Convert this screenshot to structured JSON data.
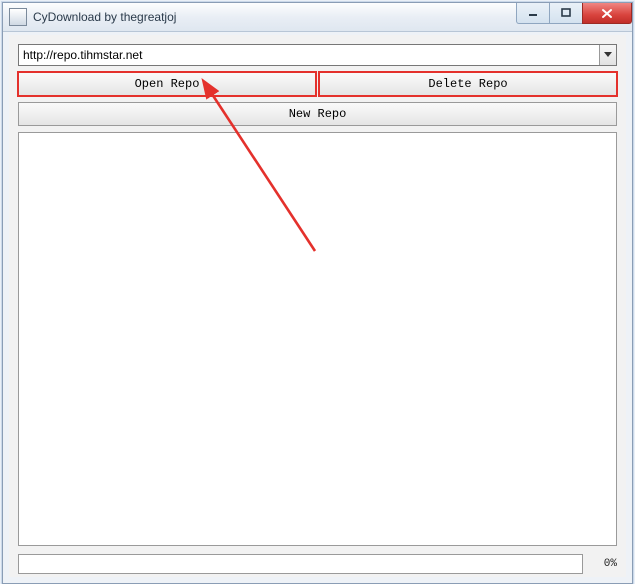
{
  "window": {
    "title": "CyDownload by thegreatjoj"
  },
  "url_field": {
    "value": "http://repo.tihmstar.net"
  },
  "buttons": {
    "open_repo": "Open Repo",
    "delete_repo": "Delete Repo",
    "new_repo": "New Repo"
  },
  "progress": {
    "percent_label": "0%"
  },
  "annotation": {
    "color": "#e4312c"
  }
}
